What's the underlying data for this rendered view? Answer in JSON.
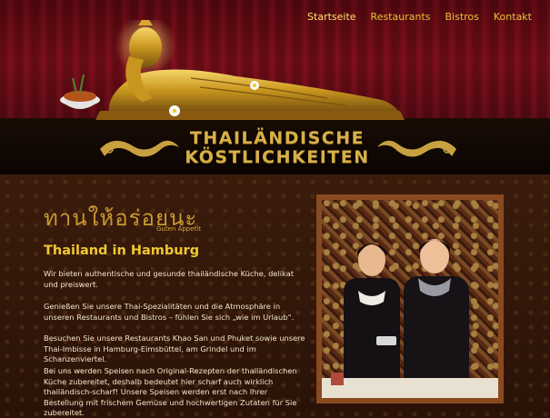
{
  "nav": {
    "items": [
      "Startseite",
      "Restaurants",
      "Bistros",
      "Kontakt"
    ],
    "active_index": 0
  },
  "header": {
    "title_line1": "THAILÄNDISCHE",
    "title_line2": "KÖSTLICHKEITEN"
  },
  "main": {
    "thai_greeting": "ทานให้อร่อยนะ",
    "thai_greeting_translation": "Guten Appetit",
    "heading": "Thailand in Hamburg",
    "paragraphs": [
      "Wir bieten authentische und gesunde thailändische Küche, delikat und preiswert.",
      "Genießen Sie unsere Thai-Spezialitäten und die Atmosphäre in unseren Restaurants und Bistros – fühlen Sie sich „wie im Urlaub“.",
      "Besuchen Sie unsere Restaurants Khao San und Phuket sowie unsere Thai-Imbisse in Hamburg-Eimsbüttel, am Grindel und im Schanzenviertel.",
      "Bei uns werden Speisen nach Original-Rezepten der thailändischen Küche zubereitet, deshalb bedeutet hier scharf auch wirklich thailändisch-scharf! Unsere Speisen werden erst nach Ihrer Bestellung mit frischem Gemüse und hochwertigen Zutaten für Sie zubereitet."
    ]
  },
  "colors": {
    "nav_link": "#e8c23a",
    "heading": "#f0c830",
    "body_text": "#f4e6c8",
    "photo_frame": "#8a4a20"
  }
}
